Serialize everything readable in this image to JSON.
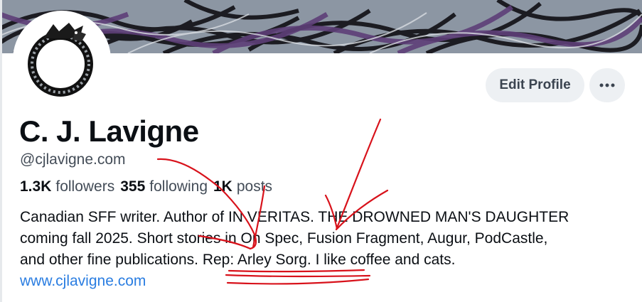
{
  "profile": {
    "display_name": "C. J. Lavigne",
    "handle": "@cjlavigne.com",
    "stats": {
      "followers_count": "1.3K",
      "followers_label": "followers",
      "following_count": "355",
      "following_label": "following",
      "posts_count": "1K",
      "posts_label": "posts"
    },
    "bio_lines": [
      "Canadian SFF writer. Author of IN VERITAS. THE DROWNED MAN'S DAUGHTER",
      "coming fall 2025. Short stories in On Spec, Fusion Fragment, Augur, PodCastle,",
      "and other fine publications. Rep: Arley Sorg. I like coffee and cats."
    ],
    "website": "www.cjlavigne.com"
  },
  "actions": {
    "edit_profile_label": "Edit Profile",
    "more_icon": "ellipsis-icon"
  },
  "avatar": {
    "icon": "ouroboros-dragon-icon"
  },
  "colors": {
    "button_bg": "#edf0f3",
    "link": "#2a7de1",
    "muted_text": "#434c57",
    "annotation_red": "#d8121b",
    "banner_purple": "#5e3f78"
  }
}
